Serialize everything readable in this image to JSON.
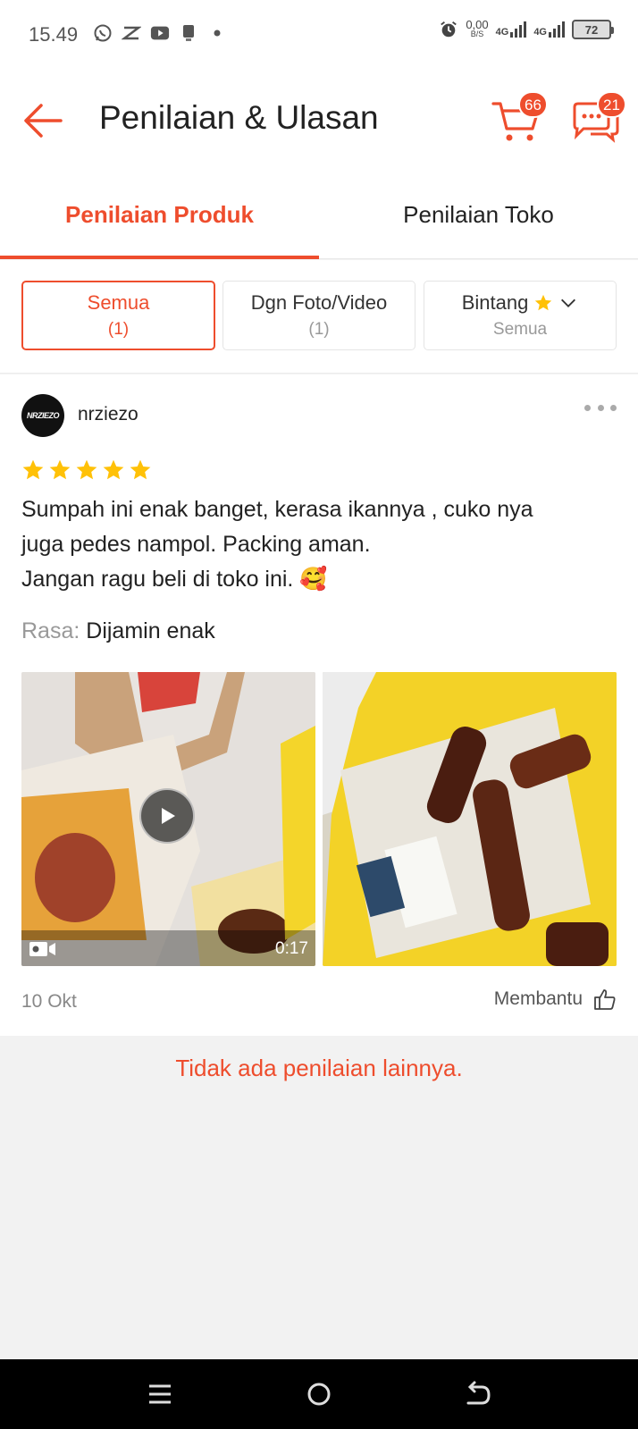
{
  "status_bar": {
    "time": "15.49",
    "speed_value": "0,00",
    "speed_unit": "B/S",
    "network_1": "4G",
    "network_2": "4G",
    "battery": "72"
  },
  "header": {
    "title": "Penilaian & Ulasan",
    "cart_badge": "66",
    "chat_badge": "21"
  },
  "tabs": [
    {
      "label": "Penilaian Produk",
      "active": true
    },
    {
      "label": "Penilaian Toko",
      "active": false
    }
  ],
  "filters": [
    {
      "label": "Semua",
      "count": "(1)",
      "active": true
    },
    {
      "label": "Dgn Foto/Video",
      "count": "(1)",
      "active": false
    },
    {
      "label": "Bintang",
      "count": "Semua",
      "active": false
    }
  ],
  "review": {
    "username": "nrziezo",
    "avatar_text": "NRZIEZO",
    "rating": 5,
    "comment": "Sumpah ini enak banget, kerasa ikannya , cuko nya\njuga pedes nampol. Packing aman.\nJangan ragu beli di toko ini. 🥰",
    "variant_key": "Rasa:",
    "variant_value": "Dijamin enak",
    "video_duration": "0:17",
    "date": "10 Okt",
    "helpful_label": "Membantu"
  },
  "footer_message": "Tidak ada penilaian lainnya.",
  "colors": {
    "accent": "#ee4d2d",
    "star": "#ffc107"
  }
}
